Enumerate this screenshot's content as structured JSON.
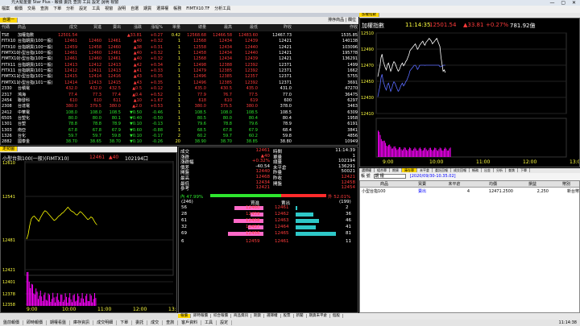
{
  "window": {
    "title": "元大點金靈 Star Plus - 報價 委託 查詢 工具 設定 說明 視窗",
    "controls": "— ▢ ✕"
  },
  "menubar": [
    "檔案",
    "報價",
    "交易",
    "查詢",
    "下單",
    "分析",
    "設定",
    "工具",
    "視窗",
    "說明",
    "自選",
    "期貨",
    "選擇權",
    "帳務",
    "FIMTX10.TF",
    "分析工具"
  ],
  "quote_tab": "自選一",
  "quote_tools": "排序商品 | 欄位",
  "quote_cols": [
    "代碼",
    "商品",
    "成交",
    "買進",
    "賣出",
    "漲跌",
    "漲幅%",
    "單量",
    "總量",
    "最高",
    "最低",
    "昨收",
    "作收"
  ],
  "quotes": [
    {
      "code": "TSE",
      "name": "加權指數",
      "px": "12501.54",
      "bid": "",
      "ask": "",
      "chg": "▲33.81",
      "pct": "+0.27",
      "vol": "0.42",
      "tot": "12568.68",
      "hi": "12466.58",
      "lo": "12483.60",
      "prev": "12467.73",
      "last": "1535.85",
      "cls": "red"
    },
    {
      "code": "FITX10",
      "name": "台指期貨(100一般)",
      "px": "12461",
      "bid": "12460",
      "ask": "12461",
      "chg": "▲40",
      "pct": "+0.32",
      "vol": "1",
      "tot": "12568",
      "hi": "12434",
      "lo": "12439",
      "prev": "12421",
      "last": "140138",
      "cls": "red"
    },
    {
      "code": "FITX10",
      "name": "台指期貨(100一般)",
      "px": "12459",
      "bid": "12458",
      "ask": "12460",
      "chg": "▲38",
      "pct": "+0.31",
      "vol": "1",
      "tot": "12558",
      "hi": "12434",
      "lo": "12440",
      "prev": "12421",
      "last": "103096",
      "cls": "red"
    },
    {
      "code": "FIMTX10",
      "name": "小型台指(100一般)",
      "px": "12461",
      "bid": "12460",
      "ask": "12461",
      "chg": "▲40",
      "pct": "+0.32",
      "vol": "1",
      "tot": "12458",
      "hi": "12434",
      "lo": "12440",
      "prev": "12421",
      "last": "195778",
      "cls": "red"
    },
    {
      "code": "FIMTX10",
      "name": "小型台指(100一般)",
      "px": "12461",
      "bid": "12460",
      "ask": "12461",
      "chg": "▲40",
      "pct": "+0.32",
      "vol": "1",
      "tot": "12568",
      "hi": "12434",
      "lo": "12439",
      "prev": "12421",
      "last": "136291",
      "cls": "red"
    },
    {
      "code": "FITX11",
      "name": "台指期貨(101一般)",
      "px": "12413",
      "bid": "12412",
      "ask": "12413",
      "chg": "▲42",
      "pct": "+0.34",
      "vol": "2",
      "tot": "12498",
      "hi": "12388",
      "lo": "12392",
      "prev": "12371",
      "last": "1499",
      "cls": "red"
    },
    {
      "code": "FITX11",
      "name": "台指期貨(101一般)",
      "px": "12412",
      "bid": "12411",
      "ask": "12413",
      "chg": "▲41",
      "pct": "+0.33",
      "vol": "1",
      "tot": "12479",
      "hi": "12385",
      "lo": "12392",
      "prev": "12371",
      "last": "1662",
      "cls": "red"
    },
    {
      "code": "FIMTX11",
      "name": "小型台指(101一般)",
      "px": "12415",
      "bid": "12414",
      "ask": "12416",
      "chg": "▲43",
      "pct": "+0.35",
      "vol": "1",
      "tot": "12496",
      "hi": "12385",
      "lo": "12357",
      "prev": "12371",
      "last": "5755",
      "cls": "red"
    },
    {
      "code": "FIMTX11",
      "name": "小型台指(101一般)",
      "px": "12414",
      "bid": "12413",
      "ask": "12415",
      "chg": "▲43",
      "pct": "+0.35",
      "vol": "1",
      "tot": "12496",
      "hi": "12385",
      "lo": "12392",
      "prev": "12371",
      "last": "3691",
      "cls": "red"
    },
    {
      "code": "2330",
      "name": "台積電",
      "px": "432.0",
      "bid": "432.0",
      "ask": "432.5",
      "chg": "▲0.5",
      "pct": "+0.12",
      "vol": "1",
      "tot": "435.0",
      "hi": "430.5",
      "lo": "435.0",
      "prev": "431.0",
      "last": "47270",
      "cls": "red"
    },
    {
      "code": "2317",
      "name": "鴻海",
      "px": "77.4",
      "bid": "77.3",
      "ask": "77.4",
      "chg": "▲0.4",
      "pct": "+0.52",
      "vol": "1",
      "tot": "77.9",
      "hi": "76.7",
      "lo": "77.5",
      "prev": "77.0",
      "last": "36475",
      "cls": "red"
    },
    {
      "code": "2454",
      "name": "聯發科",
      "px": "610",
      "bid": "610",
      "ask": "611",
      "chg": "▲10",
      "pct": "+1.67",
      "vol": "1",
      "tot": "618",
      "hi": "610",
      "lo": "619",
      "prev": "600",
      "last": "6297",
      "cls": "red"
    },
    {
      "code": "2308",
      "name": "台達電",
      "px": "380.0",
      "bid": "379.5",
      "ask": "380.0",
      "chg": "▲2.0",
      "pct": "+0.53",
      "vol": "1",
      "tot": "380.0",
      "hi": "375.5",
      "lo": "380.0",
      "prev": "378.0",
      "last": "3463",
      "cls": "red"
    },
    {
      "code": "2412",
      "name": "中華電",
      "px": "108.0",
      "bid": "108.0",
      "ask": "108.5",
      "chg": "▼0.50",
      "pct": "-0.46",
      "vol": "1",
      "tot": "108.5",
      "hi": "108.0",
      "lo": "108.5",
      "prev": "108.5",
      "last": "6309",
      "cls": "grn"
    },
    {
      "code": "6505",
      "name": "台塑化",
      "px": "80.0",
      "bid": "80.0",
      "ask": "80.1",
      "chg": "▼0.40",
      "pct": "-0.50",
      "vol": "1",
      "tot": "80.5",
      "hi": "80.0",
      "lo": "80.4",
      "prev": "80.4",
      "last": "1958",
      "cls": "grn"
    },
    {
      "code": "1301",
      "name": "台塑",
      "px": "78.8",
      "bid": "78.8",
      "ask": "78.9",
      "chg": "▼0.10",
      "pct": "-0.13",
      "vol": "1",
      "tot": "79.6",
      "hi": "78.8",
      "lo": "79.6",
      "prev": "78.9",
      "last": "6191",
      "cls": "grn"
    },
    {
      "code": "1303",
      "name": "南亞",
      "px": "67.8",
      "bid": "67.8",
      "ask": "67.9",
      "chg": "▼0.60",
      "pct": "-0.88",
      "vol": "1",
      "tot": "68.5",
      "hi": "67.8",
      "lo": "67.9",
      "prev": "68.4",
      "last": "3841",
      "cls": "grn"
    },
    {
      "code": "1326",
      "name": "台化",
      "px": "59.7",
      "bid": "59.7",
      "ask": "59.8",
      "chg": "▼0.10",
      "pct": "-0.17",
      "vol": "2",
      "tot": "60.2",
      "hi": "59.7",
      "lo": "60.2",
      "prev": "59.8",
      "last": "4856",
      "cls": "grn"
    },
    {
      "code": "2882",
      "name": "國泰金",
      "px": "38.70",
      "bid": "38.65",
      "ask": "38.70",
      "chg": "▼0.10",
      "pct": "-0.26",
      "vol": "20",
      "tot": "38.90",
      "hi": "38.70",
      "lo": "38.85",
      "prev": "38.80",
      "last": "10949",
      "cls": "grn"
    }
  ],
  "index_chart": {
    "tab": "加權指數",
    "name": "加權指數",
    "time": "11:14:35",
    "price": "12501.54",
    "chg": "▲33.81",
    "pct": "+0.27%",
    "vol": "781.92億",
    "ylabels": [
      "12510",
      "12490",
      "12470",
      "12450",
      "12430",
      "12410"
    ],
    "xlabels": [
      "9:00",
      "10:00",
      "11:00",
      "12:00",
      "13:00"
    ]
  },
  "mtx_chart": {
    "tab": "走勢圖",
    "name": "小型台指100(一般)(FIMTX10)",
    "price": "12461",
    "chg": "▲40",
    "vol": "102194口",
    "ylabels": [
      "12610",
      "12541",
      "12481",
      "12421",
      "12401",
      "12378",
      "12358"
    ],
    "xlabels": [
      "9:00",
      "10:00",
      "11:00",
      "12:00",
      "13:00"
    ]
  },
  "detail": {
    "left": [
      [
        "成交",
        "12461"
      ],
      [
        "漲跌",
        "▲40"
      ],
      [
        "漲跌幅",
        "+0.32%"
      ],
      [
        "價差",
        "-40.54"
      ],
      [
        "開盤",
        "12440"
      ],
      [
        "最高",
        "12468"
      ],
      [
        "最低",
        "12434"
      ],
      [
        "參考",
        "12421"
      ]
    ],
    "mid": [
      [
        "時間",
        "11:14:39"
      ],
      [
        "單量",
        "1"
      ],
      [
        "總量",
        "102194"
      ],
      [
        "未平倉",
        "136291"
      ],
      [
        "昨量",
        "50021"
      ],
      [
        "昨收",
        "12421"
      ],
      [
        "開盤",
        "12458"
      ],
      [
        "",
        "12454"
      ]
    ],
    "ratio_left": "內 47.99%",
    "ratio_right": "外 52.01%",
    "book_head": [
      "(246)",
      "買進",
      "賣出",
      "(199)"
    ],
    "book": [
      [
        "56",
        "12460",
        "12461",
        "2"
      ],
      [
        "28",
        "12459",
        "12462",
        "36"
      ],
      [
        "61",
        "12458",
        "12463",
        "46"
      ],
      [
        "32",
        "12457",
        "12464",
        "41"
      ],
      [
        "69",
        "12456",
        "12465",
        "81"
      ]
    ],
    "book_total": [
      "6",
      "12459",
      "12461",
      "11"
    ]
  },
  "order": {
    "tabs": [
      "選擇權",
      "組合單",
      "期貨",
      "庫存單",
      "未平倉",
      "委託回報",
      "成交回報",
      "帳務",
      "出金",
      "分析",
      "查詢",
      "下單"
    ],
    "account_label": "帳  號",
    "account": "期 權",
    "date": "[2020/09/30-10.35.02]",
    "cols": [
      "商品",
      "買賣",
      "未平倉",
      "均價",
      "損益",
      "幣別"
    ],
    "rows": [
      [
        "小型台指100",
        "賣出",
        "4",
        "12471.2500",
        "2,250",
        "新台幣"
      ]
    ]
  },
  "bottom_tabs": [
    "報價",
    "即時報價",
    "綜合報價",
    "商品資訊",
    "期貨",
    "選擇權",
    "股票",
    "新聞",
    "期貨未平倉",
    "個股"
  ],
  "status": [
    "盤前報價",
    "即時報價",
    "期權看盤",
    "庫存資訊",
    "成交明細",
    "下單",
    "委託",
    "成交",
    "查詢",
    "客戶資料",
    "工具",
    "設定",
    "11:14:38"
  ]
}
